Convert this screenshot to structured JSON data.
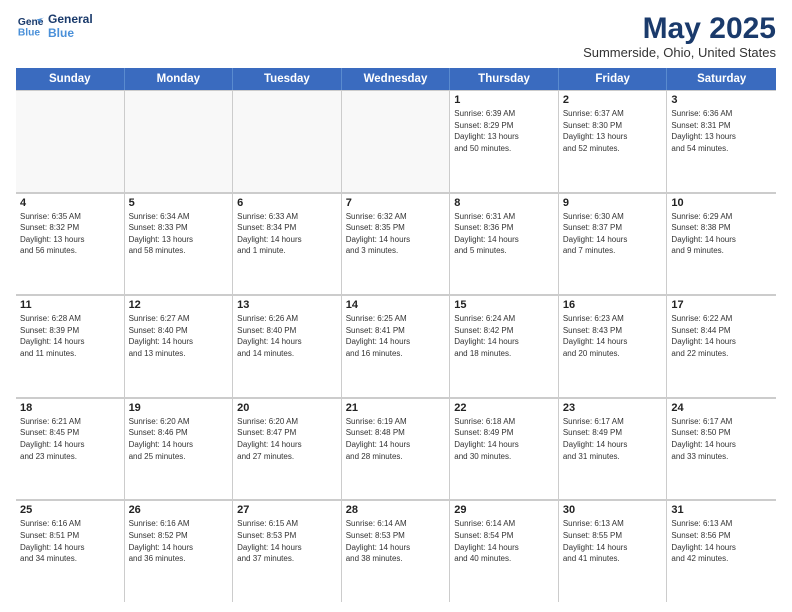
{
  "header": {
    "logo_line1": "General",
    "logo_line2": "Blue",
    "title": "May 2025",
    "subtitle": "Summerside, Ohio, United States"
  },
  "days_of_week": [
    "Sunday",
    "Monday",
    "Tuesday",
    "Wednesday",
    "Thursday",
    "Friday",
    "Saturday"
  ],
  "weeks": [
    [
      {
        "day": "",
        "info": ""
      },
      {
        "day": "",
        "info": ""
      },
      {
        "day": "",
        "info": ""
      },
      {
        "day": "",
        "info": ""
      },
      {
        "day": "1",
        "info": "Sunrise: 6:39 AM\nSunset: 8:29 PM\nDaylight: 13 hours\nand 50 minutes."
      },
      {
        "day": "2",
        "info": "Sunrise: 6:37 AM\nSunset: 8:30 PM\nDaylight: 13 hours\nand 52 minutes."
      },
      {
        "day": "3",
        "info": "Sunrise: 6:36 AM\nSunset: 8:31 PM\nDaylight: 13 hours\nand 54 minutes."
      }
    ],
    [
      {
        "day": "4",
        "info": "Sunrise: 6:35 AM\nSunset: 8:32 PM\nDaylight: 13 hours\nand 56 minutes."
      },
      {
        "day": "5",
        "info": "Sunrise: 6:34 AM\nSunset: 8:33 PM\nDaylight: 13 hours\nand 58 minutes."
      },
      {
        "day": "6",
        "info": "Sunrise: 6:33 AM\nSunset: 8:34 PM\nDaylight: 14 hours\nand 1 minute."
      },
      {
        "day": "7",
        "info": "Sunrise: 6:32 AM\nSunset: 8:35 PM\nDaylight: 14 hours\nand 3 minutes."
      },
      {
        "day": "8",
        "info": "Sunrise: 6:31 AM\nSunset: 8:36 PM\nDaylight: 14 hours\nand 5 minutes."
      },
      {
        "day": "9",
        "info": "Sunrise: 6:30 AM\nSunset: 8:37 PM\nDaylight: 14 hours\nand 7 minutes."
      },
      {
        "day": "10",
        "info": "Sunrise: 6:29 AM\nSunset: 8:38 PM\nDaylight: 14 hours\nand 9 minutes."
      }
    ],
    [
      {
        "day": "11",
        "info": "Sunrise: 6:28 AM\nSunset: 8:39 PM\nDaylight: 14 hours\nand 11 minutes."
      },
      {
        "day": "12",
        "info": "Sunrise: 6:27 AM\nSunset: 8:40 PM\nDaylight: 14 hours\nand 13 minutes."
      },
      {
        "day": "13",
        "info": "Sunrise: 6:26 AM\nSunset: 8:40 PM\nDaylight: 14 hours\nand 14 minutes."
      },
      {
        "day": "14",
        "info": "Sunrise: 6:25 AM\nSunset: 8:41 PM\nDaylight: 14 hours\nand 16 minutes."
      },
      {
        "day": "15",
        "info": "Sunrise: 6:24 AM\nSunset: 8:42 PM\nDaylight: 14 hours\nand 18 minutes."
      },
      {
        "day": "16",
        "info": "Sunrise: 6:23 AM\nSunset: 8:43 PM\nDaylight: 14 hours\nand 20 minutes."
      },
      {
        "day": "17",
        "info": "Sunrise: 6:22 AM\nSunset: 8:44 PM\nDaylight: 14 hours\nand 22 minutes."
      }
    ],
    [
      {
        "day": "18",
        "info": "Sunrise: 6:21 AM\nSunset: 8:45 PM\nDaylight: 14 hours\nand 23 minutes."
      },
      {
        "day": "19",
        "info": "Sunrise: 6:20 AM\nSunset: 8:46 PM\nDaylight: 14 hours\nand 25 minutes."
      },
      {
        "day": "20",
        "info": "Sunrise: 6:20 AM\nSunset: 8:47 PM\nDaylight: 14 hours\nand 27 minutes."
      },
      {
        "day": "21",
        "info": "Sunrise: 6:19 AM\nSunset: 8:48 PM\nDaylight: 14 hours\nand 28 minutes."
      },
      {
        "day": "22",
        "info": "Sunrise: 6:18 AM\nSunset: 8:49 PM\nDaylight: 14 hours\nand 30 minutes."
      },
      {
        "day": "23",
        "info": "Sunrise: 6:17 AM\nSunset: 8:49 PM\nDaylight: 14 hours\nand 31 minutes."
      },
      {
        "day": "24",
        "info": "Sunrise: 6:17 AM\nSunset: 8:50 PM\nDaylight: 14 hours\nand 33 minutes."
      }
    ],
    [
      {
        "day": "25",
        "info": "Sunrise: 6:16 AM\nSunset: 8:51 PM\nDaylight: 14 hours\nand 34 minutes."
      },
      {
        "day": "26",
        "info": "Sunrise: 6:16 AM\nSunset: 8:52 PM\nDaylight: 14 hours\nand 36 minutes."
      },
      {
        "day": "27",
        "info": "Sunrise: 6:15 AM\nSunset: 8:53 PM\nDaylight: 14 hours\nand 37 minutes."
      },
      {
        "day": "28",
        "info": "Sunrise: 6:14 AM\nSunset: 8:53 PM\nDaylight: 14 hours\nand 38 minutes."
      },
      {
        "day": "29",
        "info": "Sunrise: 6:14 AM\nSunset: 8:54 PM\nDaylight: 14 hours\nand 40 minutes."
      },
      {
        "day": "30",
        "info": "Sunrise: 6:13 AM\nSunset: 8:55 PM\nDaylight: 14 hours\nand 41 minutes."
      },
      {
        "day": "31",
        "info": "Sunrise: 6:13 AM\nSunset: 8:56 PM\nDaylight: 14 hours\nand 42 minutes."
      }
    ]
  ]
}
